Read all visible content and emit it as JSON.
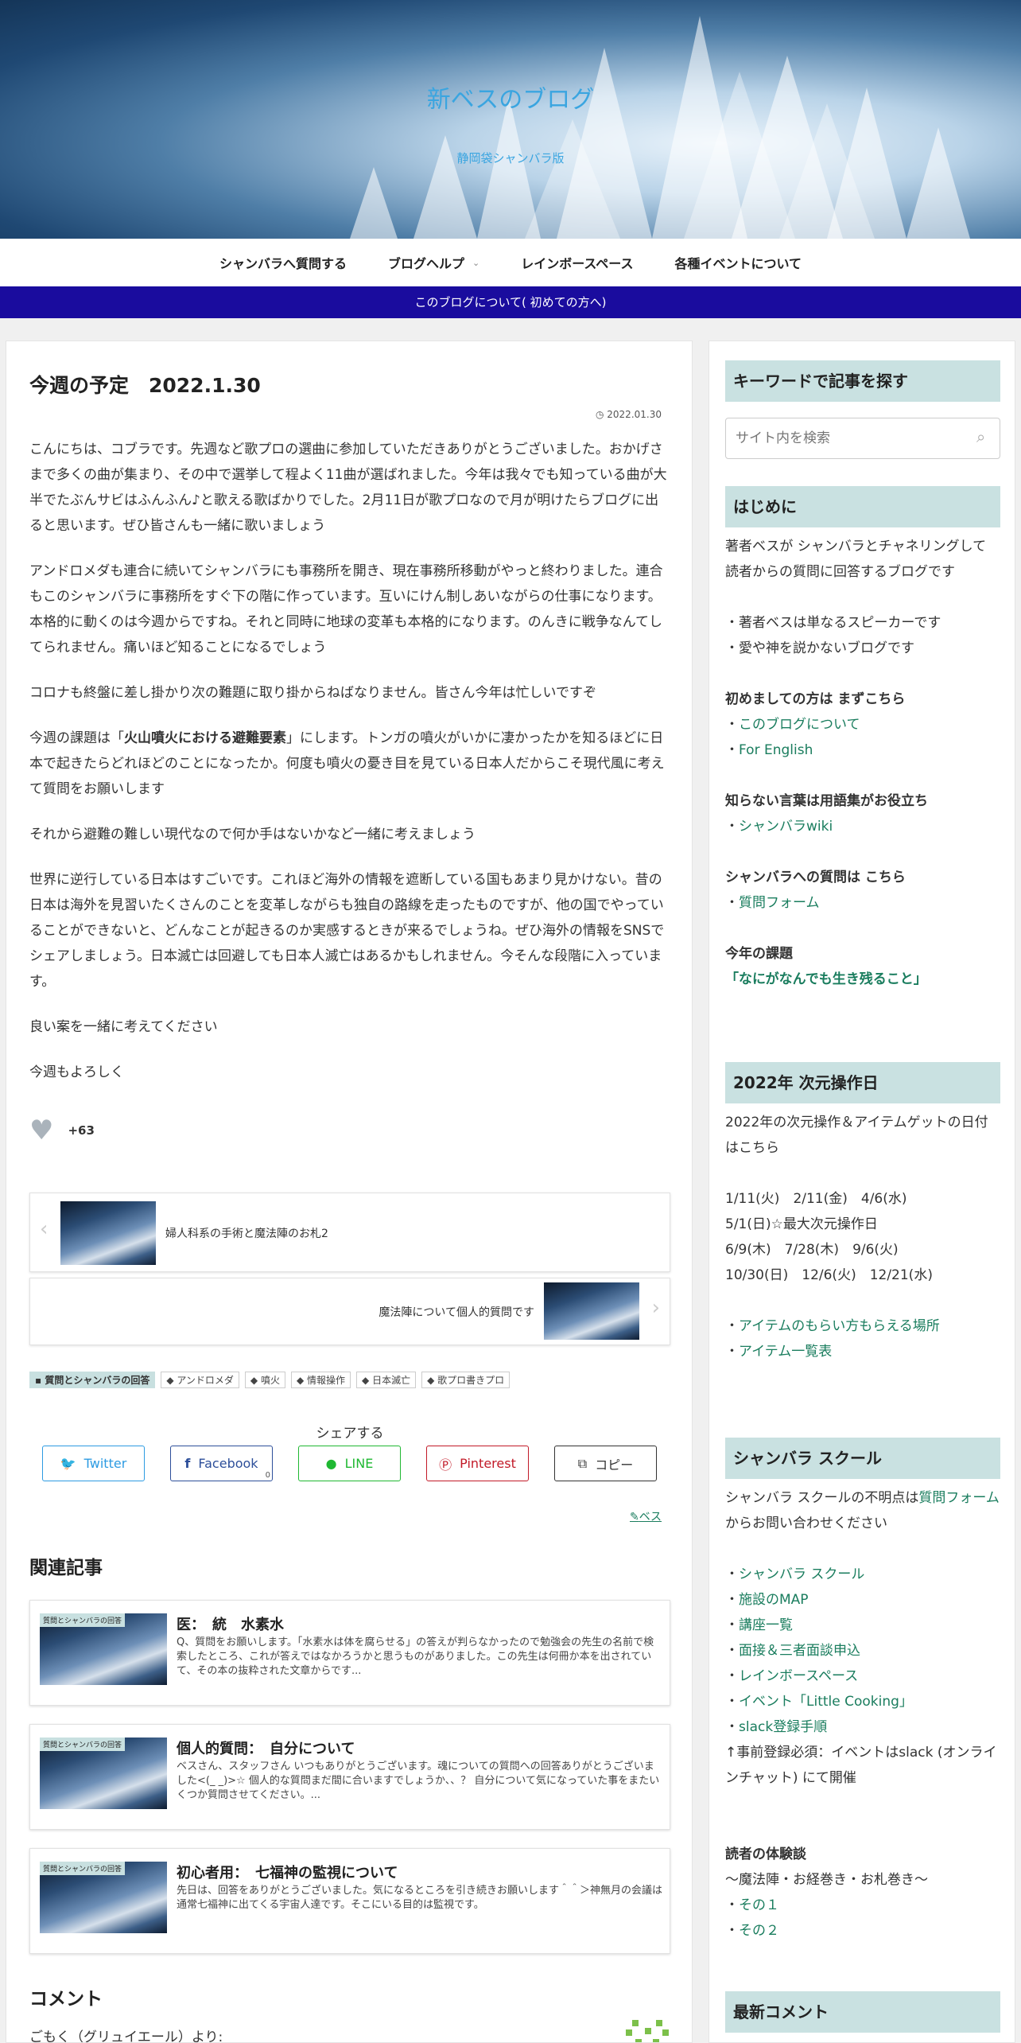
{
  "header": {
    "site_title": "新ベスのブログ",
    "site_subtitle": "静岡袋シャンバラ版"
  },
  "nav": {
    "items": [
      "シャンバラへ質問する",
      "ブログヘルプ",
      "レインボースペース",
      "各種イベントについて"
    ]
  },
  "notice": "このブログについて( 初めての方へ)",
  "post": {
    "title": "今週の予定　2022.1.30",
    "date": "2022.01.30",
    "paragraphs": [
      "こんにちは、コブラです。先週など歌プロの選曲に参加していただきありがとうございました。おかげさまで多くの曲が集まり、その中で選挙して程よく11曲が選ばれました。今年は我々でも知っている曲が大半でたぶんサビはふんふん♪と歌える歌ばかりでした。2月11日が歌プロなので月が明けたらブログに出ると思います。ぜひ皆さんも一緒に歌いましょう",
      "アンドロメダも連合に続いてシャンバラにも事務所を開き、現在事務所移動がやっと終わりました。連合もこのシャンバラに事務所をすぐ下の階に作っています。互いにけん制しあいながらの仕事になります。本格的に動くのは今週からですね。それと同時に地球の変革も本格的になります。のんきに戦争なんてしてられません。痛いほど知ることになるでしょう",
      "コロナも終盤に差し掛かり次の難題に取り掛からねばなりません。皆さん今年は忙しいですぞ",
      "",
      "それから避難の難しい現代なので何か手はないかなど一緒に考えましょう",
      "世界に逆行している日本はすごいです。これほど海外の情報を遮断している国もあまり見かけない。昔の日本は海外を見習いたくさんのことを変革しながらも独自の路線を走ったものですが、他の国でやっていることができないと、どんなことが起きるのか実感するときが来るでしょうね。ぜひ海外の情報をSNSでシェアしましょう。日本滅亡は回避しても日本人滅亡はあるかもしれません。今そんな段階に入っています。",
      "良い案を一緒に考えてください",
      "今週もよろしく"
    ],
    "para4_pre": "今週の課題は「",
    "para4_bold": "火山噴火における避難要素",
    "para4_post": "」にします。トンガの噴火がいかに凄かったかを知るほどに日本で起きたらどれほどのことになったか。何度も噴火の憂き目を見ている日本人だからこそ現代風に考えて質問をお願いします",
    "like_count": "+63",
    "prev_post": "婦人科系の手術と魔法陣のお札2",
    "next_post": "魔法陣について個人的質問です",
    "category": "質問とシャンバラの回答",
    "tags": [
      "アンドロメダ",
      "噴火",
      "情報操作",
      "日本滅亡",
      "歌プロ書きプロ"
    ],
    "share_title": "シェアする",
    "share_buttons": [
      {
        "label": "Twitter",
        "color": "#2d9be2"
      },
      {
        "label": "Facebook",
        "color": "#2d4f9a",
        "count": "0"
      },
      {
        "label": "LINE",
        "color": "#1fb832"
      },
      {
        "label": "Pinterest",
        "color": "#c21a28"
      },
      {
        "label": "コピー",
        "color": "#333333"
      }
    ],
    "author": "ベス"
  },
  "related": {
    "heading": "関連記事",
    "items": [
      {
        "badge": "質問とシャンバラの回答",
        "title": "医：　統　水素水",
        "snippet": "Q、質問をお願いします。「水素水は体を腐らせる」の答えが判らなかったので勉強会の先生の名前で検索したところ、これが答えではなかろうかと思うものがありました。この先生は何冊か本を出されていて、その本の抜粋された文章からです..."
      },
      {
        "badge": "質問とシャンバラの回答",
        "title": "個人的質問：　自分について",
        "snippet": "ベスさん、スタッフさん いつもありがとうございます。魂についての質問への回答ありがとうございました&lt;(_ _)&gt;☆ 個人的な質問まだ間に合いますでしょうか、、？ 自分について気になっていた事をまたいくつか質問させてください。..."
      },
      {
        "badge": "質問とシャンバラの回答",
        "title": "初心者用：　七福神の監視について",
        "snippet": "先日は、回答をありがとうございました。気になるところを引き続きお願いします＾＾＞神無月の会議は通常七福神に出てくる宇宙人達です。そこにいる目的は監視です。"
      }
    ]
  },
  "comments": {
    "heading": "コメント",
    "first_commenter": "ごもく（グリュイエール）より:"
  },
  "sidebar": {
    "search_heading": "キーワードで記事を探す",
    "search_placeholder": "サイト内を検索",
    "intro_heading": "はじめに",
    "intro_text": "著者ベスが シャンバラとチャネリングして 読者からの質問に回答するブログです",
    "intro_bullets": [
      "・著者ベスは単なるスピーカーです",
      "・愛や神を説かないブログです"
    ],
    "first_time_label": "初めましての方は まずこちら",
    "first_time_links": [
      "このブログについて",
      "For English"
    ],
    "glossary_label": "知らない言葉は用語集がお役立ち",
    "glossary_link": "シャンバラwiki",
    "question_label": "シャンバラへの質問は こちら",
    "question_link": "質問フォーム",
    "theme_label": "今年の課題",
    "theme_link": "「なにがなんでも生き残ること」",
    "ops_heading": "2022年 次元操作日",
    "ops_intro": "2022年の次元操作＆アイテムゲットの日付はこちら",
    "ops_dates": [
      "1/11(火)　2/11(金)　4/6(水)",
      "5/1(日)☆最大次元操作日",
      "6/9(木)　7/28(木)　9/6(火)",
      "10/30(日)　12/6(火)　12/21(水)"
    ],
    "ops_links": [
      "アイテムのもらい方もらえる場所",
      "アイテム一覧表"
    ],
    "school_heading": "シャンバラ スクール",
    "school_intro_pre": "シャンバラ スクールの不明点は",
    "school_intro_link": "質問フォーム",
    "school_intro_post": "からお問い合わせください",
    "school_links": [
      "シャンバラ スクール",
      "施設のMAP",
      "講座一覧",
      "面接＆三者面談申込",
      "レインボースペース",
      "イベント「Little Cooking」",
      "slack登録手順"
    ],
    "school_note": "↑事前登録必須：イベントはslack (オンラインチャット) にて開催",
    "reader_label": "読者の体験談",
    "reader_sub": "〜魔法陣・お経巻き・お札巻き〜",
    "reader_links": [
      "その１",
      "その２"
    ],
    "recent_heading": "最新コメント"
  }
}
